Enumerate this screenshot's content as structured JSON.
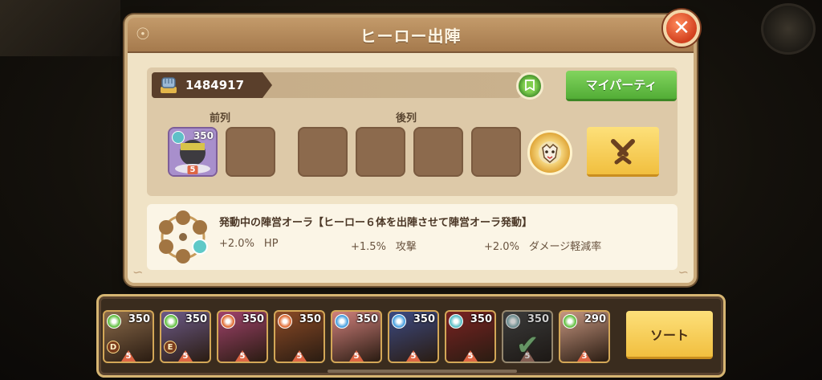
{
  "dialog": {
    "title": "ヒーロー出陣",
    "close_icon": "close-icon"
  },
  "power": {
    "value": "1484917",
    "icon": "fist-icon"
  },
  "buttons": {
    "my_party": "マイパーティ",
    "sort": "ソート"
  },
  "lineup": {
    "front_label": "前列",
    "back_label": "後列",
    "front_slots": [
      {
        "filled": true,
        "level": "350",
        "stars": "5",
        "element": "skull-icon"
      },
      {
        "filled": false
      }
    ],
    "back_slots": [
      {
        "filled": false
      },
      {
        "filled": false
      },
      {
        "filled": false
      },
      {
        "filled": false
      }
    ]
  },
  "aura": {
    "title": "発動中の陣営オーラ【ヒーロー６体を出陣させて陣営オーラ発動】",
    "stats": [
      {
        "value": "+2.0%",
        "label": "HP"
      },
      {
        "value": "+1.5%",
        "label": "攻撃"
      },
      {
        "value": "+2.0%",
        "label": "ダメージ軽減率"
      }
    ]
  },
  "roster": [
    {
      "level": "350",
      "stars": "5",
      "grade": "D",
      "element": "nature-icon",
      "color": "#8a6a4a"
    },
    {
      "level": "350",
      "stars": "5",
      "grade": "E",
      "element": "nature-icon",
      "color": "#6c5a88"
    },
    {
      "level": "350",
      "stars": "5",
      "grade": "",
      "element": "fire-icon",
      "color": "#a0426b"
    },
    {
      "level": "350",
      "stars": "5",
      "grade": "",
      "element": "fire-icon",
      "color": "#8b4a26"
    },
    {
      "level": "350",
      "stars": "5",
      "grade": "",
      "element": "holy-icon",
      "color": "#d0807c"
    },
    {
      "level": "350",
      "stars": "5",
      "grade": "",
      "element": "holy-icon",
      "color": "#3c4a82"
    },
    {
      "level": "350",
      "stars": "5",
      "grade": "",
      "element": "skull-icon",
      "color": "#7a2222"
    },
    {
      "level": "350",
      "stars": "5",
      "grade": "",
      "element": "skull-icon",
      "color": "#4a4a48",
      "selected": true
    },
    {
      "level": "290",
      "stars": "3",
      "grade": "",
      "element": "nature-icon",
      "color": "#c69680"
    }
  ]
}
